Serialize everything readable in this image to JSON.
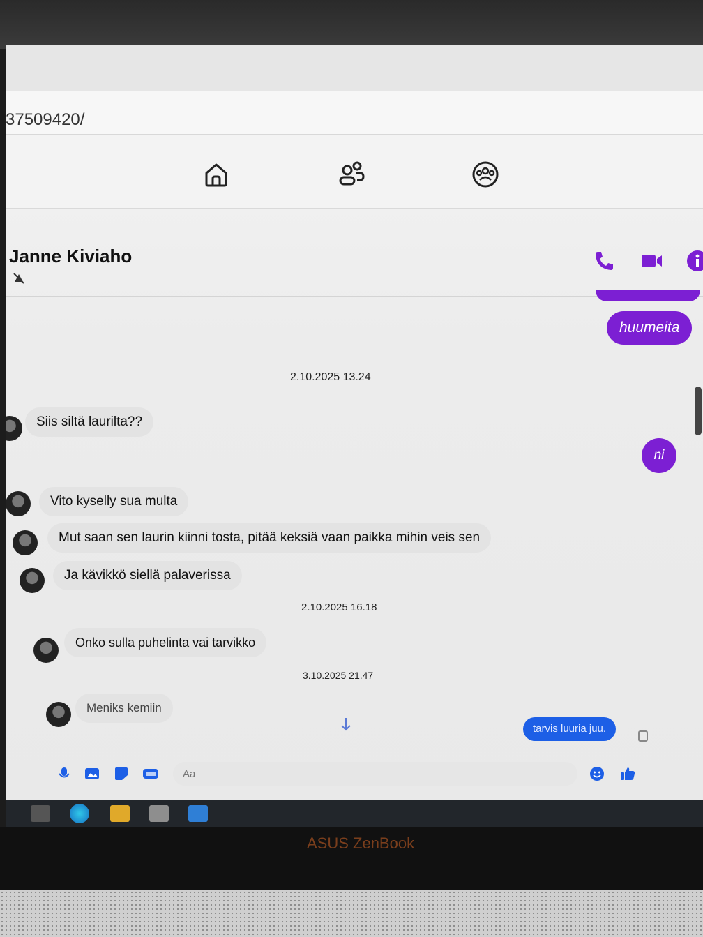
{
  "browser": {
    "url": "37509420/"
  },
  "conversation": {
    "contact_name": "Janne Kiviaho"
  },
  "colors": {
    "accent": "#7c1fd3",
    "sent_blue": "#1d5fe6",
    "incoming_bubble": "#e3e3e3"
  },
  "messages": {
    "top_out_1": "huumeita",
    "ts_1": "2.10.2025 13.24",
    "in_1": "Siis siltä laurilta??",
    "out_2": "ni",
    "in_2": "Vito kyselly sua multa",
    "in_3": "Mut saan sen laurin kiinni tosta, pitää keksiä vaan paikka mihin veis sen",
    "in_4": "Ja kävikkö siellä palaverissa",
    "ts_2": "2.10.2025 16.18",
    "in_5": "Onko sulla puhelinta vai tarvikko",
    "ts_3": "3.10.2025 21.47",
    "in_6": "Meniks kemiin",
    "out_3": "tarvis luuria juu."
  },
  "composer": {
    "placeholder": "Aa"
  },
  "laptop": {
    "brand": "ASUS ZenBook"
  }
}
